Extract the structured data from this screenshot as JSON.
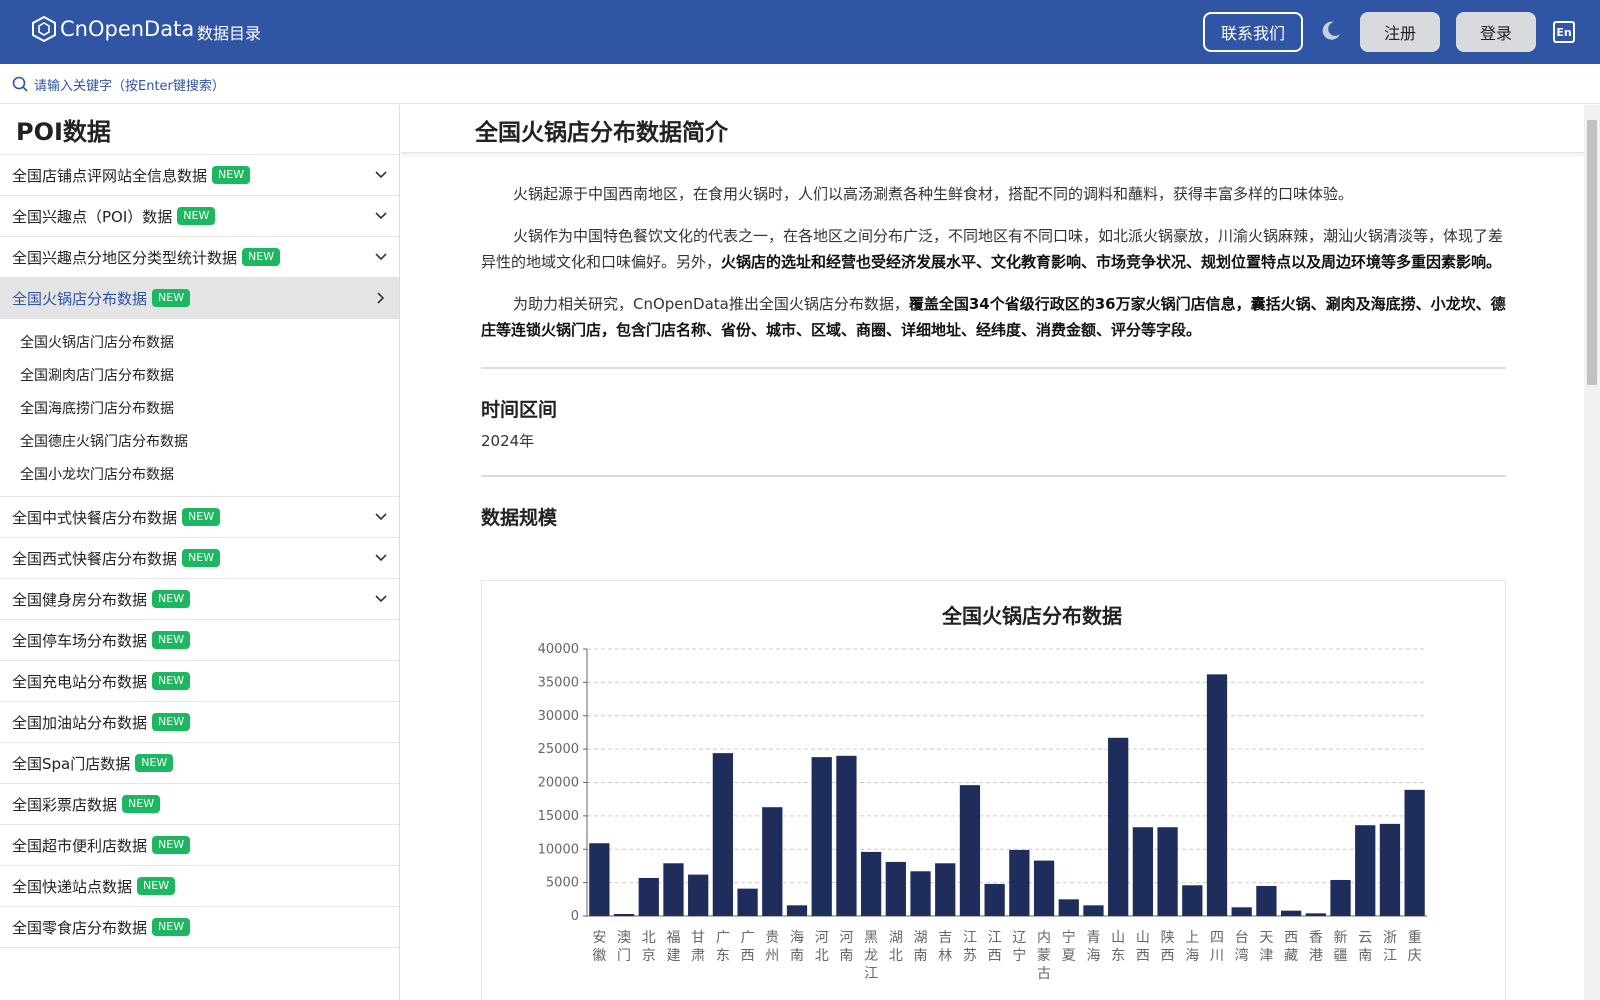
{
  "header": {
    "logo_text": "CnOpenData",
    "nav_catalog": "数据目录",
    "contact": "联系我们",
    "register": "注册",
    "login": "登录",
    "lang": "En"
  },
  "search": {
    "placeholder": "请输入关键字（按Enter键搜索）"
  },
  "sidebar": {
    "title": "POI数据",
    "badge": "NEW",
    "items": [
      {
        "label": "全国店铺点评网站全信息数据",
        "expandable": true
      },
      {
        "label": "全国兴趣点（POI）数据",
        "expandable": true
      },
      {
        "label": "全国兴趣点分地区分类型统计数据",
        "expandable": true
      },
      {
        "label": "全国火锅店分布数据",
        "expandable": true,
        "active": true
      }
    ],
    "subitems": [
      "全国火锅店门店分布数据",
      "全国涮肉店门店分布数据",
      "全国海底捞门店分布数据",
      "全国德庄火锅门店分布数据",
      "全国小龙坎门店分布数据"
    ],
    "items_after": [
      {
        "label": "全国中式快餐店分布数据",
        "expandable": true
      },
      {
        "label": "全国西式快餐店分布数据",
        "expandable": true
      },
      {
        "label": "全国健身房分布数据",
        "expandable": true
      },
      {
        "label": "全国停车场分布数据",
        "expandable": false
      },
      {
        "label": "全国充电站分布数据",
        "expandable": false
      },
      {
        "label": "全国加油站分布数据",
        "expandable": false
      },
      {
        "label": "全国Spa门店数据",
        "expandable": false
      },
      {
        "label": "全国彩票店数据",
        "expandable": false
      },
      {
        "label": "全国超市便利店数据",
        "expandable": false
      },
      {
        "label": "全国快递站点数据",
        "expandable": false
      },
      {
        "label": "全国零食店分布数据",
        "expandable": false
      }
    ]
  },
  "main": {
    "title": "全国火锅店分布数据简介",
    "p1": "火锅起源于中国西南地区，在食用火锅时，人们以高汤涮煮各种生鲜食材，搭配不同的调料和蘸料，获得丰富多样的口味体验。",
    "p2_normal": "火锅作为中国特色餐饮文化的代表之一，在各地区之间分布广泛，不同地区有不同口味，如北派火锅豪放，川渝火锅麻辣，潮汕火锅清淡等，体现了差异性的地域文化和口味偏好。另外，",
    "p2_bold": "火锅店的选址和经营也受经济发展水平、文化教育影响、市场竞争状况、规划位置特点以及周边环境等多重因素影响。",
    "p3_normal": "为助力相关研究，CnOpenData推出全国火锅店分布数据，",
    "p3_bold": "覆盖全国34个省级行政区的36万家火锅门店信息，囊括火锅、涮肉及海底捞、小龙坎、德庄等连锁火锅门店，包含门店名称、省份、城市、区域、商圈、详细地址、经纬度、消费金额、评分等字段。",
    "period_heading": "时间区间",
    "period_value": "2024年",
    "scale_heading": "数据规模"
  },
  "chart_data": {
    "type": "bar",
    "title": "全国火锅店分布数据",
    "ylim": [
      0,
      40000
    ],
    "yticks": [
      "0",
      "5000",
      "10000",
      "15000",
      "20000",
      "25000",
      "30000",
      "35000",
      "40000"
    ],
    "grid": true,
    "color": "#1f2d5c",
    "categories": [
      "安徽",
      "澳门",
      "北京",
      "福建",
      "甘肃",
      "广东",
      "广西",
      "贵州",
      "海南",
      "河北",
      "河南",
      "黑龙江",
      "湖北",
      "湖南",
      "吉林",
      "江苏",
      "江西",
      "辽宁",
      "内蒙古",
      "宁夏",
      "青海",
      "山东",
      "山西",
      "陕西",
      "上海",
      "四川",
      "台湾",
      "天津",
      "西藏",
      "香港",
      "新疆",
      "云南",
      "浙江",
      "重庆"
    ],
    "values": [
      10900,
      300,
      5700,
      7900,
      6200,
      24400,
      4100,
      16300,
      1600,
      23800,
      24000,
      9600,
      8100,
      6700,
      7900,
      19600,
      4800,
      9900,
      8300,
      2500,
      1600,
      26700,
      13300,
      13300,
      4600,
      36200,
      1300,
      4500,
      800,
      400,
      5400,
      13600,
      13800,
      18900
    ]
  }
}
